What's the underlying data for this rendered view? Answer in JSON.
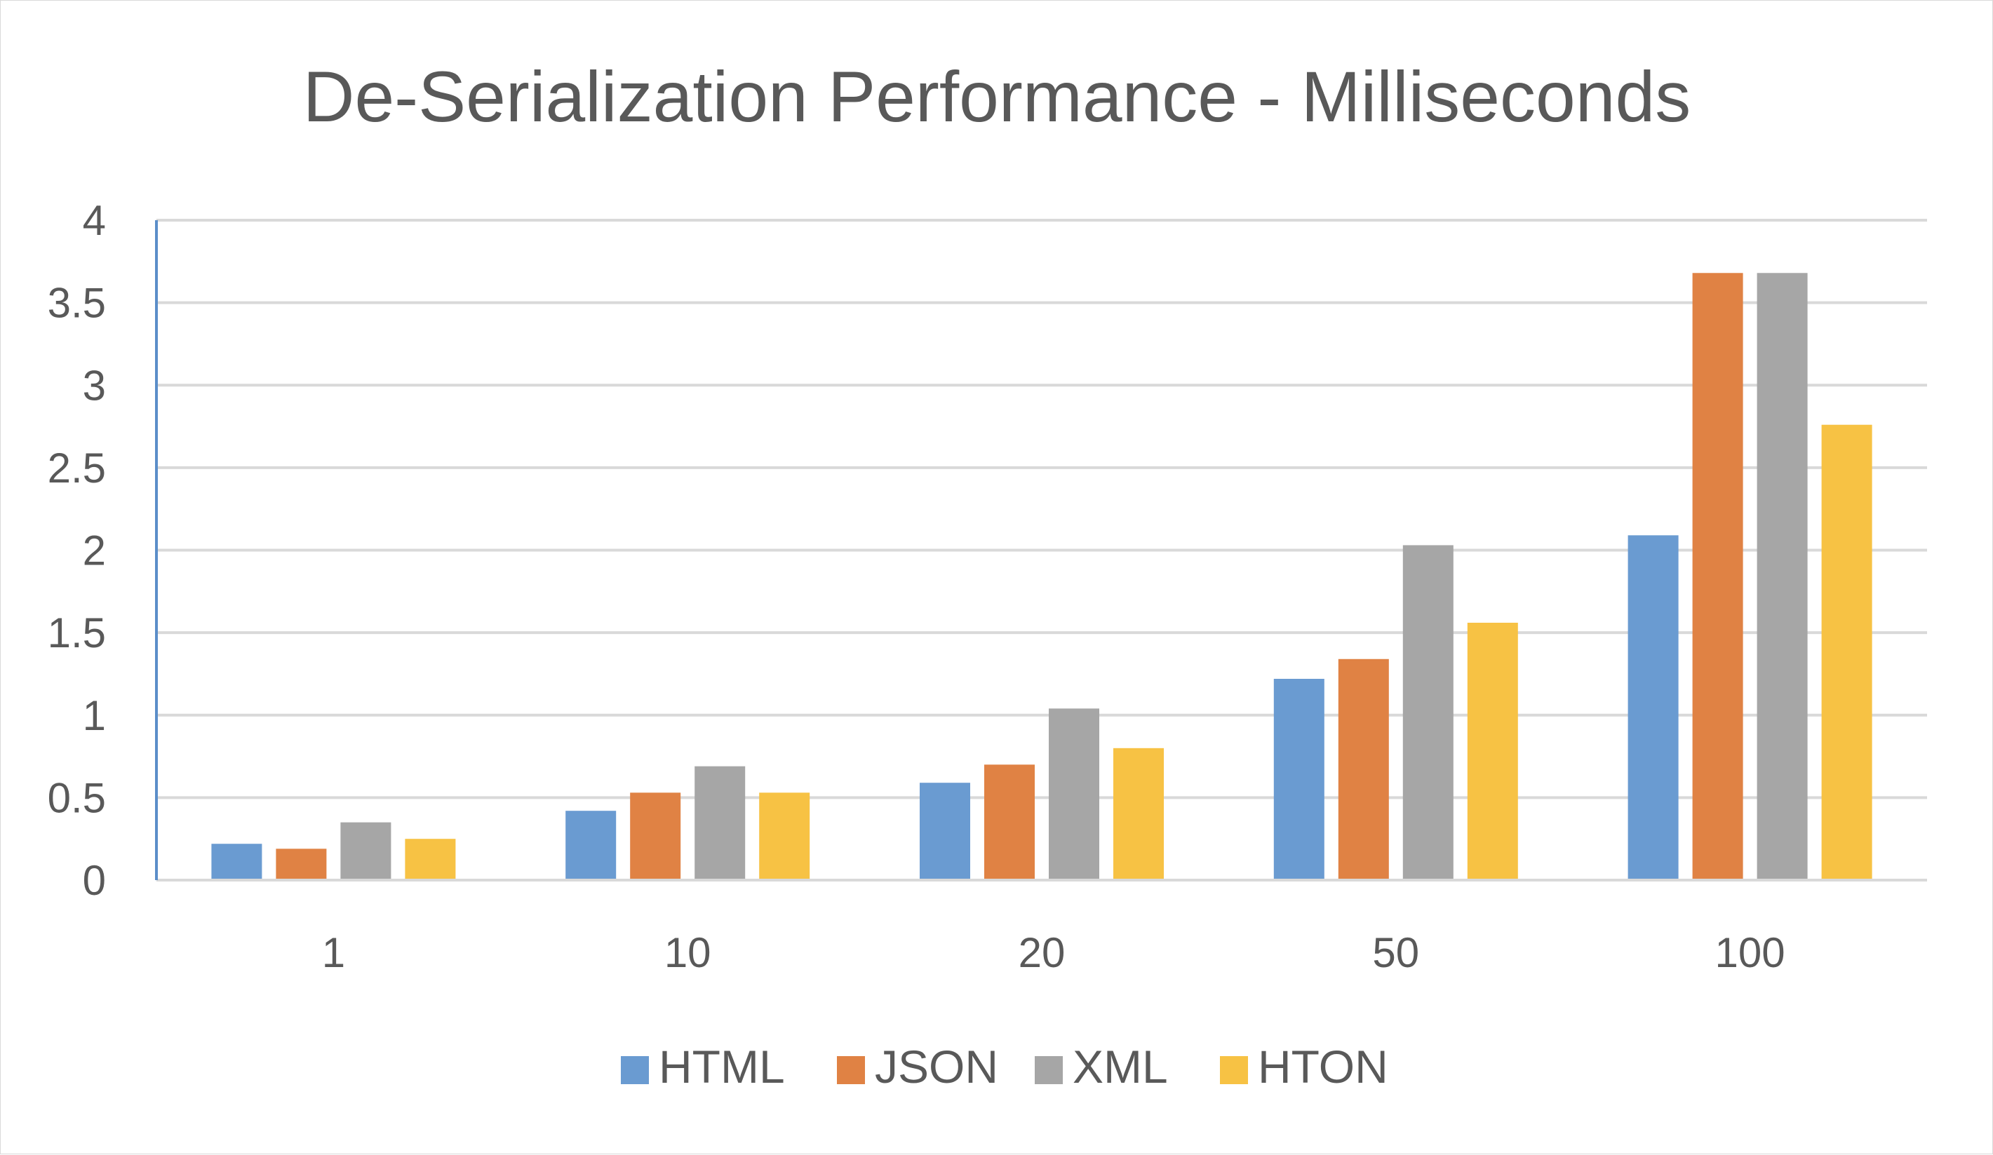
{
  "chart_data": {
    "type": "bar",
    "title": "De-Serialization Performance - Milliseconds",
    "xlabel": "",
    "ylabel": "",
    "categories": [
      "1",
      "10",
      "20",
      "50",
      "100"
    ],
    "ylim": [
      0,
      4
    ],
    "yticks": [
      "0",
      "0.5",
      "1",
      "1.5",
      "2",
      "2.5",
      "3",
      "3.5",
      "4"
    ],
    "ytick_values": [
      0,
      0.5,
      1,
      1.5,
      2,
      2.5,
      3,
      3.5,
      4
    ],
    "grid": true,
    "legend_position": "bottom",
    "series": [
      {
        "name": "HTML",
        "color": "#6a9bd1",
        "values": [
          0.22,
          0.42,
          0.59,
          1.22,
          2.09
        ]
      },
      {
        "name": "JSON",
        "color": "#e08244",
        "values": [
          0.19,
          0.53,
          0.7,
          1.34,
          3.68
        ]
      },
      {
        "name": "XML",
        "color": "#a6a6a6",
        "values": [
          0.35,
          0.69,
          1.04,
          2.03,
          3.68
        ]
      },
      {
        "name": "HTON",
        "color": "#f7c244",
        "values": [
          0.25,
          0.53,
          0.8,
          1.56,
          2.76
        ]
      }
    ]
  }
}
